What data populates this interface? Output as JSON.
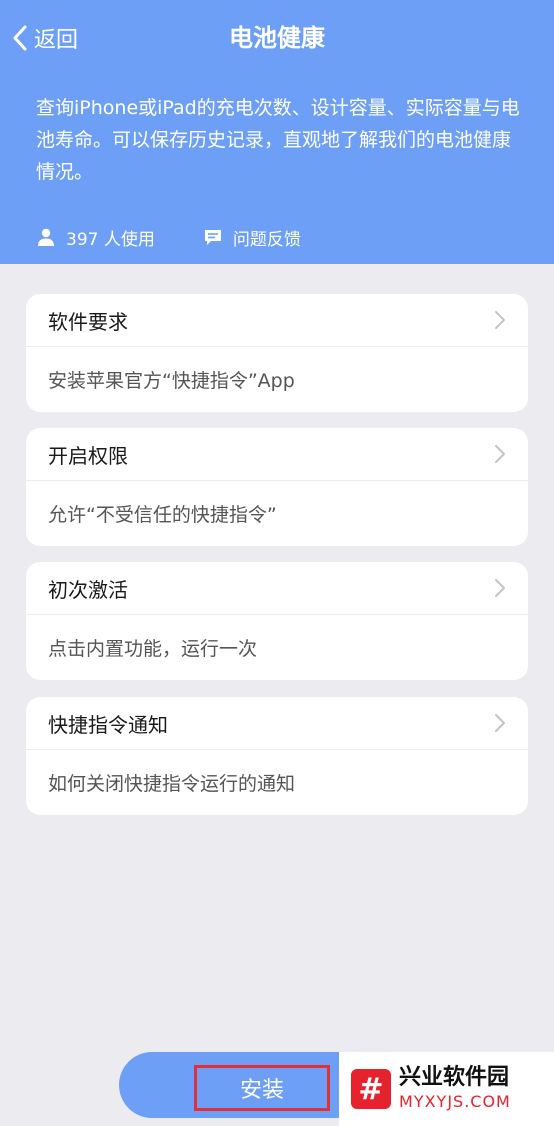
{
  "header": {
    "back_label": "返回",
    "title": "电池健康",
    "description": "查询iPhone或iPad的充电次数、设计容量、实际容量与电池寿命。可以保存历史记录，直观地了解我们的电池健康情况。",
    "users": "397 人使用",
    "feedback": "问题反馈"
  },
  "cards": [
    {
      "title": "软件要求",
      "body": "安装苹果官方“快捷指令”App"
    },
    {
      "title": "开启权限",
      "body": "允许“不受信任的快捷指令”"
    },
    {
      "title": "初次激活",
      "body": "点击内置功能，运行一次"
    },
    {
      "title": "快捷指令通知",
      "body": "如何关闭快捷指令运行的通知"
    }
  ],
  "install": {
    "label": "安装"
  },
  "watermark": {
    "logo": "#",
    "name": "兴业软件园",
    "domain": "MYXYJS.COM"
  },
  "colors": {
    "header_bg": "#6e9ff7",
    "page_bg": "#ebebf0",
    "highlight": "#e0313a",
    "brand_red": "#e5222d"
  }
}
